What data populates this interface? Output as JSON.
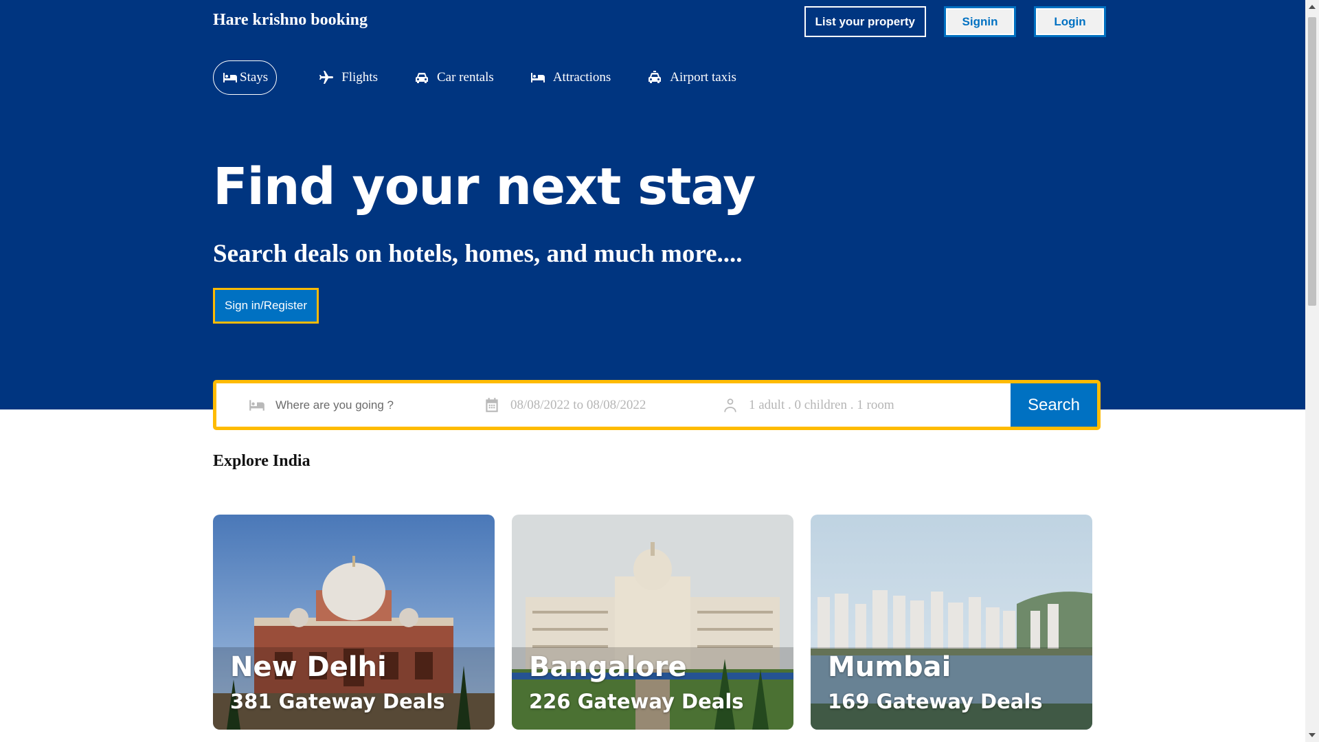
{
  "header": {
    "brand": "Hare krishno booking",
    "list_property": "List your property",
    "signin": "Signin",
    "login": "Login"
  },
  "nav": {
    "items": [
      {
        "label": "Stays",
        "icon": "bed-icon"
      },
      {
        "label": "Flights",
        "icon": "plane-icon"
      },
      {
        "label": "Car rentals",
        "icon": "car-icon"
      },
      {
        "label": "Attractions",
        "icon": "bed-icon"
      },
      {
        "label": "Airport taxis",
        "icon": "taxi-icon"
      }
    ]
  },
  "hero": {
    "title": "Find your next stay",
    "subtitle": "Search deals on hotels, homes, and much more....",
    "register": "Sign in/Register"
  },
  "search": {
    "destination_placeholder": "Where are you going ?",
    "dates": "08/08/2022 to 08/08/2022",
    "guests": "1 adult . 0 children . 1 room",
    "button": "Search"
  },
  "explore": {
    "title": "Explore India",
    "cards": [
      {
        "city": "New Delhi",
        "deals": "381 Gateway Deals"
      },
      {
        "city": "Bangalore",
        "deals": "226 Gateway Deals"
      },
      {
        "city": "Mumbai",
        "deals": "169 Gateway Deals"
      }
    ]
  },
  "colors": {
    "brand_blue": "#003580",
    "accent_blue": "#0071c2",
    "highlight_yellow": "#febb02"
  }
}
